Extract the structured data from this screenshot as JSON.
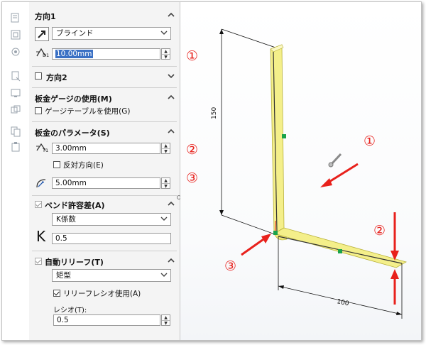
{
  "direction1": {
    "title": "方向1",
    "end_condition": "ブラインド",
    "depth_value": "10.00mm",
    "depth_icon_label": "D1"
  },
  "direction2": {
    "title": "方向2"
  },
  "gauge": {
    "title": "板金ゲージの使用(M)",
    "use_table_label": "ゲージテーブルを使用(G)"
  },
  "params": {
    "title": "板金のパラメータ(S)",
    "thickness_icon_label": "T1",
    "thickness_value": "3.00mm",
    "reverse_label": "反対方向(E)",
    "radius_value": "5.00mm"
  },
  "bend_allowance": {
    "title": "ベンド許容差(A)",
    "type": "K係数",
    "k_symbol": "K",
    "k_value": "0.5"
  },
  "relief": {
    "title": "自動リリーフ(T)",
    "type": "矩型",
    "use_ratio_label": "リリーフレシオ使用(A)",
    "ratio_label": "レシオ(T):",
    "ratio_value": "0.5"
  },
  "callouts": {
    "c1": "①",
    "c2": "②",
    "c3": "③"
  },
  "dimensions": {
    "height": "150",
    "width": "100"
  },
  "colors": {
    "accent_red": "#e8211c",
    "part_yellow": "#f4ef8a",
    "selection_blue": "#3a70c4",
    "handle_green": "#1aa34a"
  }
}
